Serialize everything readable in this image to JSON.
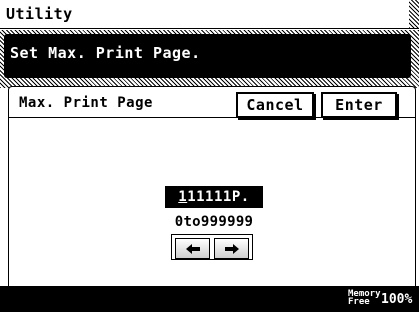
{
  "title": "Utility",
  "message": "Set Max. Print Page.",
  "panel": {
    "title": "Max. Print Page",
    "cancel_label": "Cancel",
    "enter_label": "Enter"
  },
  "input": {
    "cursor_char": "1",
    "rest": "11111P.",
    "range": "0to999999"
  },
  "arrows": {
    "left_icon": "left-arrow-icon",
    "right_icon": "right-arrow-icon"
  },
  "footer": {
    "memory_label_line1": "Memory",
    "memory_label_line2": "Free",
    "memory_value": "100%"
  }
}
